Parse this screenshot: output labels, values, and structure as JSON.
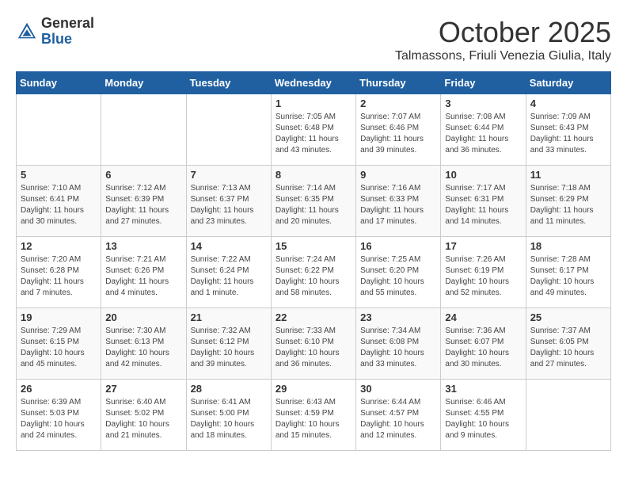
{
  "header": {
    "logo_general": "General",
    "logo_blue": "Blue",
    "title": "October 2025",
    "subtitle": "Talmassons, Friuli Venezia Giulia, Italy"
  },
  "weekdays": [
    "Sunday",
    "Monday",
    "Tuesday",
    "Wednesday",
    "Thursday",
    "Friday",
    "Saturday"
  ],
  "weeks": [
    [
      {
        "day": "",
        "info": ""
      },
      {
        "day": "",
        "info": ""
      },
      {
        "day": "",
        "info": ""
      },
      {
        "day": "1",
        "info": "Sunrise: 7:05 AM\nSunset: 6:48 PM\nDaylight: 11 hours\nand 43 minutes."
      },
      {
        "day": "2",
        "info": "Sunrise: 7:07 AM\nSunset: 6:46 PM\nDaylight: 11 hours\nand 39 minutes."
      },
      {
        "day": "3",
        "info": "Sunrise: 7:08 AM\nSunset: 6:44 PM\nDaylight: 11 hours\nand 36 minutes."
      },
      {
        "day": "4",
        "info": "Sunrise: 7:09 AM\nSunset: 6:43 PM\nDaylight: 11 hours\nand 33 minutes."
      }
    ],
    [
      {
        "day": "5",
        "info": "Sunrise: 7:10 AM\nSunset: 6:41 PM\nDaylight: 11 hours\nand 30 minutes."
      },
      {
        "day": "6",
        "info": "Sunrise: 7:12 AM\nSunset: 6:39 PM\nDaylight: 11 hours\nand 27 minutes."
      },
      {
        "day": "7",
        "info": "Sunrise: 7:13 AM\nSunset: 6:37 PM\nDaylight: 11 hours\nand 23 minutes."
      },
      {
        "day": "8",
        "info": "Sunrise: 7:14 AM\nSunset: 6:35 PM\nDaylight: 11 hours\nand 20 minutes."
      },
      {
        "day": "9",
        "info": "Sunrise: 7:16 AM\nSunset: 6:33 PM\nDaylight: 11 hours\nand 17 minutes."
      },
      {
        "day": "10",
        "info": "Sunrise: 7:17 AM\nSunset: 6:31 PM\nDaylight: 11 hours\nand 14 minutes."
      },
      {
        "day": "11",
        "info": "Sunrise: 7:18 AM\nSunset: 6:29 PM\nDaylight: 11 hours\nand 11 minutes."
      }
    ],
    [
      {
        "day": "12",
        "info": "Sunrise: 7:20 AM\nSunset: 6:28 PM\nDaylight: 11 hours\nand 7 minutes."
      },
      {
        "day": "13",
        "info": "Sunrise: 7:21 AM\nSunset: 6:26 PM\nDaylight: 11 hours\nand 4 minutes."
      },
      {
        "day": "14",
        "info": "Sunrise: 7:22 AM\nSunset: 6:24 PM\nDaylight: 11 hours\nand 1 minute."
      },
      {
        "day": "15",
        "info": "Sunrise: 7:24 AM\nSunset: 6:22 PM\nDaylight: 10 hours\nand 58 minutes."
      },
      {
        "day": "16",
        "info": "Sunrise: 7:25 AM\nSunset: 6:20 PM\nDaylight: 10 hours\nand 55 minutes."
      },
      {
        "day": "17",
        "info": "Sunrise: 7:26 AM\nSunset: 6:19 PM\nDaylight: 10 hours\nand 52 minutes."
      },
      {
        "day": "18",
        "info": "Sunrise: 7:28 AM\nSunset: 6:17 PM\nDaylight: 10 hours\nand 49 minutes."
      }
    ],
    [
      {
        "day": "19",
        "info": "Sunrise: 7:29 AM\nSunset: 6:15 PM\nDaylight: 10 hours\nand 45 minutes."
      },
      {
        "day": "20",
        "info": "Sunrise: 7:30 AM\nSunset: 6:13 PM\nDaylight: 10 hours\nand 42 minutes."
      },
      {
        "day": "21",
        "info": "Sunrise: 7:32 AM\nSunset: 6:12 PM\nDaylight: 10 hours\nand 39 minutes."
      },
      {
        "day": "22",
        "info": "Sunrise: 7:33 AM\nSunset: 6:10 PM\nDaylight: 10 hours\nand 36 minutes."
      },
      {
        "day": "23",
        "info": "Sunrise: 7:34 AM\nSunset: 6:08 PM\nDaylight: 10 hours\nand 33 minutes."
      },
      {
        "day": "24",
        "info": "Sunrise: 7:36 AM\nSunset: 6:07 PM\nDaylight: 10 hours\nand 30 minutes."
      },
      {
        "day": "25",
        "info": "Sunrise: 7:37 AM\nSunset: 6:05 PM\nDaylight: 10 hours\nand 27 minutes."
      }
    ],
    [
      {
        "day": "26",
        "info": "Sunrise: 6:39 AM\nSunset: 5:03 PM\nDaylight: 10 hours\nand 24 minutes."
      },
      {
        "day": "27",
        "info": "Sunrise: 6:40 AM\nSunset: 5:02 PM\nDaylight: 10 hours\nand 21 minutes."
      },
      {
        "day": "28",
        "info": "Sunrise: 6:41 AM\nSunset: 5:00 PM\nDaylight: 10 hours\nand 18 minutes."
      },
      {
        "day": "29",
        "info": "Sunrise: 6:43 AM\nSunset: 4:59 PM\nDaylight: 10 hours\nand 15 minutes."
      },
      {
        "day": "30",
        "info": "Sunrise: 6:44 AM\nSunset: 4:57 PM\nDaylight: 10 hours\nand 12 minutes."
      },
      {
        "day": "31",
        "info": "Sunrise: 6:46 AM\nSunset: 4:55 PM\nDaylight: 10 hours\nand 9 minutes."
      },
      {
        "day": "",
        "info": ""
      }
    ]
  ]
}
